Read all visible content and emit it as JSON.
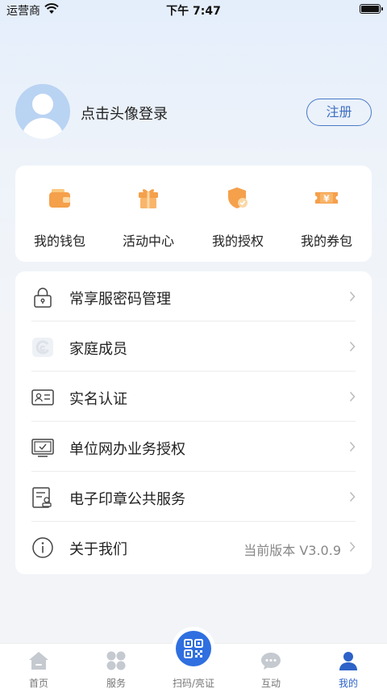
{
  "status_bar": {
    "carrier": "运营商",
    "time": "下午 7:47",
    "battery_level": 1.0
  },
  "profile": {
    "login_text": "点击头像登录",
    "register_label": "注册"
  },
  "quick_actions": [
    {
      "label": "我的钱包",
      "icon": "wallet-icon"
    },
    {
      "label": "活动中心",
      "icon": "gift-icon"
    },
    {
      "label": "我的授权",
      "icon": "shield-check-icon"
    },
    {
      "label": "我的券包",
      "icon": "coupon-icon"
    }
  ],
  "menu": [
    {
      "label": "常享服密码管理",
      "icon": "lock-icon",
      "value": ""
    },
    {
      "label": "家庭成员",
      "icon": "family-icon",
      "value": ""
    },
    {
      "label": "实名认证",
      "icon": "id-card-icon",
      "value": ""
    },
    {
      "label": "单位网办业务授权",
      "icon": "monitor-check-icon",
      "value": ""
    },
    {
      "label": "电子印章公共服务",
      "icon": "seal-document-icon",
      "value": ""
    },
    {
      "label": "关于我们",
      "icon": "info-icon",
      "value": "当前版本 V3.0.9"
    }
  ],
  "tabs": [
    {
      "label": "首页",
      "icon": "home-icon"
    },
    {
      "label": "服务",
      "icon": "grid-icon"
    },
    {
      "label": "扫码/亮证",
      "icon": "qr-code-icon"
    },
    {
      "label": "互动",
      "icon": "chat-icon"
    },
    {
      "label": "我的",
      "icon": "user-icon",
      "active": true
    }
  ],
  "colors": {
    "accent": "#2f6fe0",
    "active_tab": "#2d62c8",
    "icon_orange": "#f5a04b"
  }
}
